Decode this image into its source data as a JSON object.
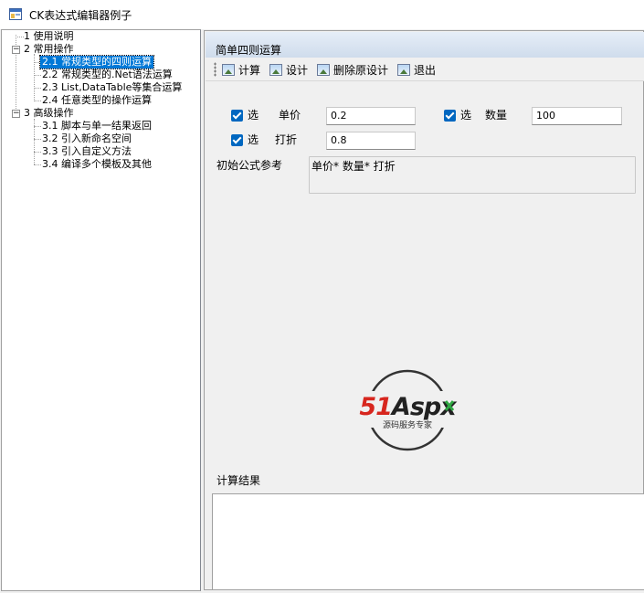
{
  "window": {
    "title": "CK表达式编辑器例子"
  },
  "tree": {
    "nodes": [
      {
        "label": "1 使用说明"
      },
      {
        "label": "2 常用操作"
      },
      {
        "label": "2.1 常规类型的四则运算"
      },
      {
        "label": "2.2 常规类型的.Net语法运算"
      },
      {
        "label": "2.3 List,DataTable等集合运算"
      },
      {
        "label": "2.4 任意类型的操作运算"
      },
      {
        "label": "3 高级操作"
      },
      {
        "label": "3.1 脚本与单一结果返回"
      },
      {
        "label": "3.2 引入新命名空间"
      },
      {
        "label": "3.3 引入自定义方法"
      },
      {
        "label": "3.4 编译多个模板及其他"
      }
    ],
    "expander_collapse_symbol": "−",
    "selected": "2.1 常规类型的四则运算"
  },
  "panel": {
    "title": "简单四则运算"
  },
  "toolbar": {
    "calc_label": "计算",
    "design_label": "设计",
    "delete_design_label": "删除原设计",
    "exit_label": "退出"
  },
  "form": {
    "select_label": "选",
    "unit_price_label": "单价",
    "unit_price_value": "0.2",
    "quantity_label": "数量",
    "quantity_value": "100",
    "discount_label": "打折",
    "discount_value": "0.8",
    "initial_formula_label": "初始公式参考",
    "initial_formula_value": "单价* 数量* 打折",
    "result_label": "计算结果"
  },
  "logo": {
    "brand": "51Aspx",
    "slogan": "源码服务专家"
  },
  "colors": {
    "selection": "#0078d7",
    "checkbox": "#0067c0",
    "logo_red": "#d7261e",
    "logo_green": "#2fa843"
  }
}
